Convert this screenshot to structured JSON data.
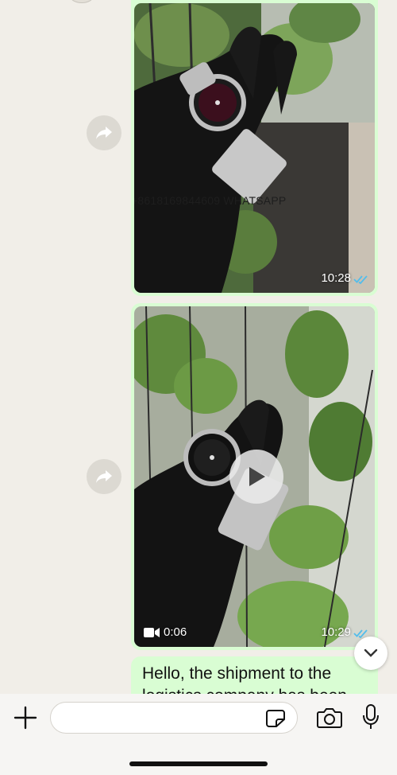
{
  "messages": [
    {
      "type": "image",
      "time": "10:28",
      "status": "read",
      "watermark": "+8618169844609 WHATSAPP"
    },
    {
      "type": "video",
      "time": "10:29",
      "duration": "0:06",
      "status": "read"
    },
    {
      "type": "text",
      "text": "Hello, the shipment to the logistics company has been"
    }
  ],
  "composer": {
    "placeholder": ""
  },
  "icons": {
    "forward": "forward-icon",
    "play": "play-icon",
    "video": "video-camera-icon",
    "scroll_down": "chevron-down-icon",
    "plus": "plus-icon",
    "sticker": "sticker-icon",
    "camera": "camera-icon",
    "mic": "microphone-icon",
    "read_receipt": "double-check-icon"
  },
  "colors": {
    "background": "#f1eee8",
    "outgoing_bubble": "#d9fdd3",
    "read_tick": "#53bdeb"
  }
}
